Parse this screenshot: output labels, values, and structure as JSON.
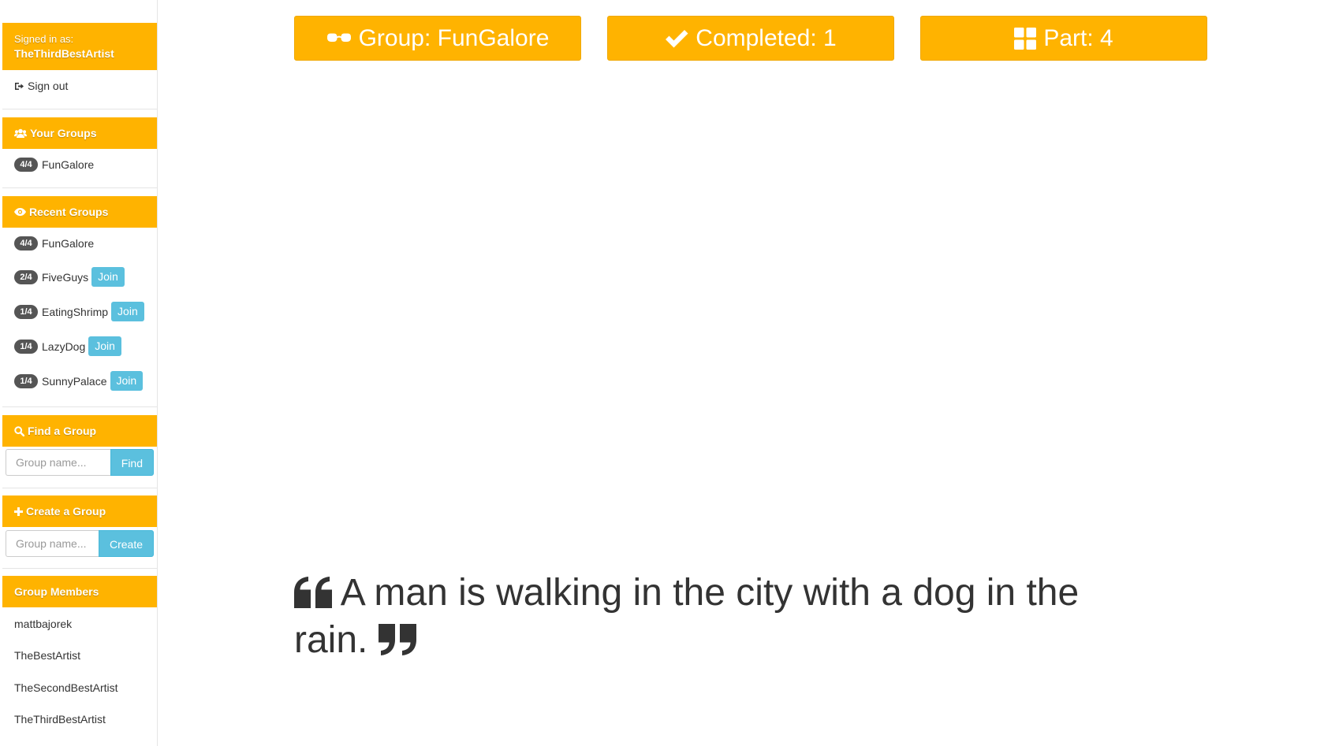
{
  "sidebar": {
    "signed_in_label": "Signed in as:",
    "username": "TheThirdBestArtist",
    "sign_out": "Sign out",
    "your_groups": {
      "title": "Your Groups",
      "items": [
        {
          "badge": "4/4",
          "name": "FunGalore"
        }
      ]
    },
    "recent_groups": {
      "title": "Recent Groups",
      "items": [
        {
          "badge": "4/4",
          "name": "FunGalore",
          "join": ""
        },
        {
          "badge": "2/4",
          "name": "FiveGuys",
          "join": "Join"
        },
        {
          "badge": "1/4",
          "name": "EatingShrimp",
          "join": "Join"
        },
        {
          "badge": "1/4",
          "name": "LazyDog",
          "join": "Join"
        },
        {
          "badge": "1/4",
          "name": "SunnyPalace",
          "join": "Join"
        }
      ]
    },
    "find_group": {
      "title": "Find a Group",
      "placeholder": "Group name...",
      "button": "Find"
    },
    "create_group": {
      "title": "Create a Group",
      "placeholder": "Group name...",
      "button": "Create"
    },
    "group_members": {
      "title": "Group Members",
      "items": [
        "mattbajorek",
        "TheBestArtist",
        "TheSecondBestArtist",
        "TheThirdBestArtist"
      ]
    }
  },
  "header": {
    "group": "Group: FunGalore",
    "completed": "Completed: 1",
    "part": "Part: 4"
  },
  "main": {
    "quote": "A man is walking in the city with a dog in the rain."
  },
  "colors": {
    "accent": "#ffb300",
    "info": "#5bc0de",
    "badge": "#555555"
  },
  "icons": {
    "sign_out": "sign-out-icon",
    "your_groups": "users-icon",
    "recent_groups": "eye-icon",
    "find_group": "search-icon",
    "create_group": "plus-icon",
    "group": "glasses-icon",
    "completed": "check-icon",
    "part": "grid-icon",
    "quote_open": "quote-left-icon",
    "quote_close": "quote-right-icon"
  }
}
